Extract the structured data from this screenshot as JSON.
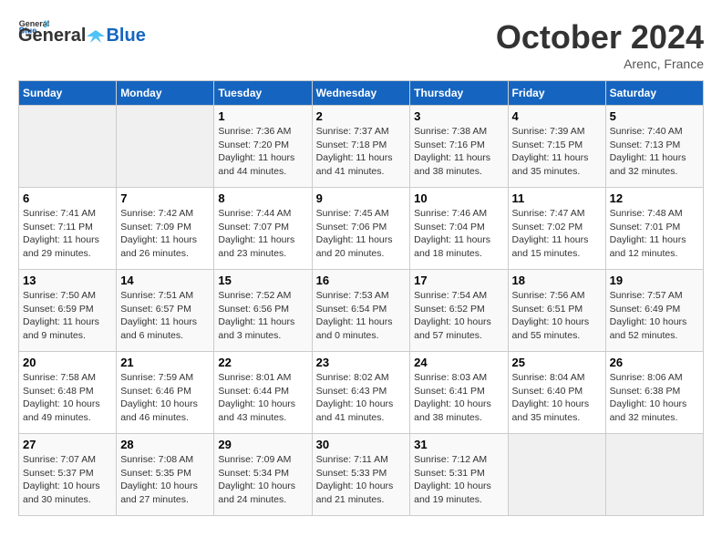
{
  "header": {
    "logo_line1": "General",
    "logo_line2": "Blue",
    "month": "October 2024",
    "location": "Arenc, France"
  },
  "days_of_week": [
    "Sunday",
    "Monday",
    "Tuesday",
    "Wednesday",
    "Thursday",
    "Friday",
    "Saturday"
  ],
  "weeks": [
    [
      {
        "day": "",
        "info": ""
      },
      {
        "day": "",
        "info": ""
      },
      {
        "day": "1",
        "sunrise": "7:36 AM",
        "sunset": "7:20 PM",
        "daylight": "11 hours and 44 minutes."
      },
      {
        "day": "2",
        "sunrise": "7:37 AM",
        "sunset": "7:18 PM",
        "daylight": "11 hours and 41 minutes."
      },
      {
        "day": "3",
        "sunrise": "7:38 AM",
        "sunset": "7:16 PM",
        "daylight": "11 hours and 38 minutes."
      },
      {
        "day": "4",
        "sunrise": "7:39 AM",
        "sunset": "7:15 PM",
        "daylight": "11 hours and 35 minutes."
      },
      {
        "day": "5",
        "sunrise": "7:40 AM",
        "sunset": "7:13 PM",
        "daylight": "11 hours and 32 minutes."
      }
    ],
    [
      {
        "day": "6",
        "sunrise": "7:41 AM",
        "sunset": "7:11 PM",
        "daylight": "11 hours and 29 minutes."
      },
      {
        "day": "7",
        "sunrise": "7:42 AM",
        "sunset": "7:09 PM",
        "daylight": "11 hours and 26 minutes."
      },
      {
        "day": "8",
        "sunrise": "7:44 AM",
        "sunset": "7:07 PM",
        "daylight": "11 hours and 23 minutes."
      },
      {
        "day": "9",
        "sunrise": "7:45 AM",
        "sunset": "7:06 PM",
        "daylight": "11 hours and 20 minutes."
      },
      {
        "day": "10",
        "sunrise": "7:46 AM",
        "sunset": "7:04 PM",
        "daylight": "11 hours and 18 minutes."
      },
      {
        "day": "11",
        "sunrise": "7:47 AM",
        "sunset": "7:02 PM",
        "daylight": "11 hours and 15 minutes."
      },
      {
        "day": "12",
        "sunrise": "7:48 AM",
        "sunset": "7:01 PM",
        "daylight": "11 hours and 12 minutes."
      }
    ],
    [
      {
        "day": "13",
        "sunrise": "7:50 AM",
        "sunset": "6:59 PM",
        "daylight": "11 hours and 9 minutes."
      },
      {
        "day": "14",
        "sunrise": "7:51 AM",
        "sunset": "6:57 PM",
        "daylight": "11 hours and 6 minutes."
      },
      {
        "day": "15",
        "sunrise": "7:52 AM",
        "sunset": "6:56 PM",
        "daylight": "11 hours and 3 minutes."
      },
      {
        "day": "16",
        "sunrise": "7:53 AM",
        "sunset": "6:54 PM",
        "daylight": "11 hours and 0 minutes."
      },
      {
        "day": "17",
        "sunrise": "7:54 AM",
        "sunset": "6:52 PM",
        "daylight": "10 hours and 57 minutes."
      },
      {
        "day": "18",
        "sunrise": "7:56 AM",
        "sunset": "6:51 PM",
        "daylight": "10 hours and 55 minutes."
      },
      {
        "day": "19",
        "sunrise": "7:57 AM",
        "sunset": "6:49 PM",
        "daylight": "10 hours and 52 minutes."
      }
    ],
    [
      {
        "day": "20",
        "sunrise": "7:58 AM",
        "sunset": "6:48 PM",
        "daylight": "10 hours and 49 minutes."
      },
      {
        "day": "21",
        "sunrise": "7:59 AM",
        "sunset": "6:46 PM",
        "daylight": "10 hours and 46 minutes."
      },
      {
        "day": "22",
        "sunrise": "8:01 AM",
        "sunset": "6:44 PM",
        "daylight": "10 hours and 43 minutes."
      },
      {
        "day": "23",
        "sunrise": "8:02 AM",
        "sunset": "6:43 PM",
        "daylight": "10 hours and 41 minutes."
      },
      {
        "day": "24",
        "sunrise": "8:03 AM",
        "sunset": "6:41 PM",
        "daylight": "10 hours and 38 minutes."
      },
      {
        "day": "25",
        "sunrise": "8:04 AM",
        "sunset": "6:40 PM",
        "daylight": "10 hours and 35 minutes."
      },
      {
        "day": "26",
        "sunrise": "8:06 AM",
        "sunset": "6:38 PM",
        "daylight": "10 hours and 32 minutes."
      }
    ],
    [
      {
        "day": "27",
        "sunrise": "7:07 AM",
        "sunset": "5:37 PM",
        "daylight": "10 hours and 30 minutes."
      },
      {
        "day": "28",
        "sunrise": "7:08 AM",
        "sunset": "5:35 PM",
        "daylight": "10 hours and 27 minutes."
      },
      {
        "day": "29",
        "sunrise": "7:09 AM",
        "sunset": "5:34 PM",
        "daylight": "10 hours and 24 minutes."
      },
      {
        "day": "30",
        "sunrise": "7:11 AM",
        "sunset": "5:33 PM",
        "daylight": "10 hours and 21 minutes."
      },
      {
        "day": "31",
        "sunrise": "7:12 AM",
        "sunset": "5:31 PM",
        "daylight": "10 hours and 19 minutes."
      },
      {
        "day": "",
        "info": ""
      },
      {
        "day": "",
        "info": ""
      }
    ]
  ]
}
